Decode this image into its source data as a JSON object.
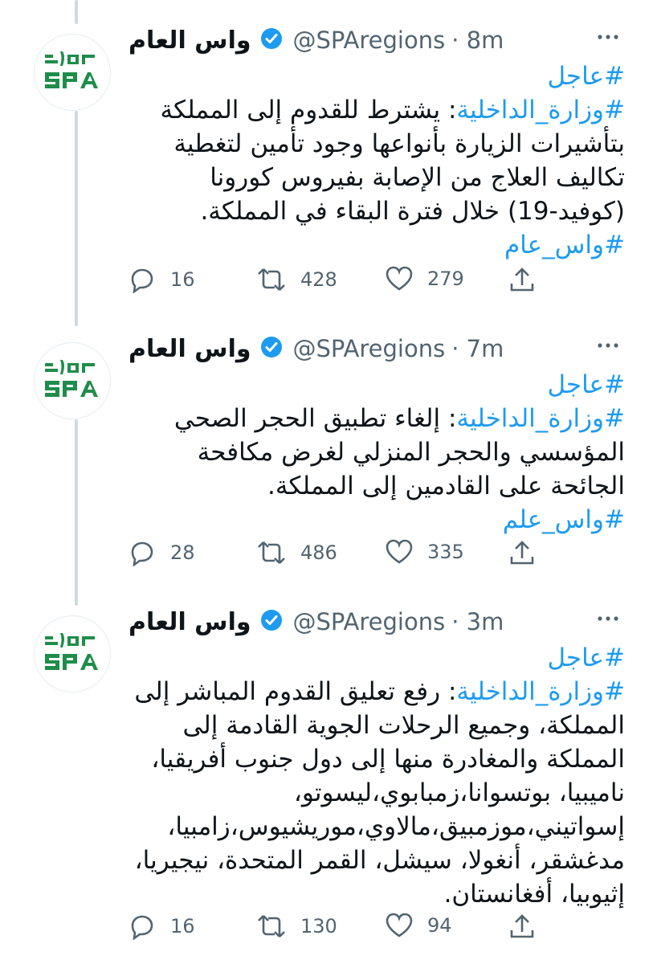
{
  "account": {
    "name": "واس العام",
    "handle": "@SPAregions",
    "verified": true,
    "logo_text": "واس SPA"
  },
  "colors": {
    "accent": "#1d9bf0",
    "logo_green": "#1f8d4a",
    "muted": "#536471"
  },
  "tweets": [
    {
      "time": "· 8m",
      "hashtag_urgent": "#عاجل",
      "ministry_tag": "#وزارة_الداخلية",
      "text": ": يشترط للقدوم إلى المملكة بتأشيرات الزيارة بأنواعها وجود تأمين لتغطية تكاليف العلاج من الإصابة بفيروس كورونا (كوفيد-19) خلال فترة البقاء في المملكة.",
      "footer_tag": "#واس_عام",
      "replies": "16",
      "retweets": "428",
      "likes": "279"
    },
    {
      "time": "· 7m",
      "hashtag_urgent": "#عاجل",
      "ministry_tag": "#وزارة_الداخلية",
      "text": ": إلغاء تطبيق الحجر الصحي المؤسسي والحجر المنزلي لغرض مكافحة الجائحة على القادمين إلى المملكة.",
      "footer_tag": "#واس_علم",
      "replies": "28",
      "retweets": "486",
      "likes": "335"
    },
    {
      "time": "· 3m",
      "hashtag_urgent": "#عاجل",
      "ministry_tag": "#وزارة_الداخلية",
      "text": ": رفع تعليق القدوم المباشر إلى المملكة، وجميع الرحلات الجوية القادمة إلى المملكة والمغادرة منها إلى دول جنوب أفريقيا، ناميبيا، بوتسوانا،زمبابوي،ليسوتو، إسواتيني،موزمبيق،مالاوي،موريشيوس،زامبيا، مدغشقر، أنغولا، سيشل، القمر المتحدة، نيجيريا، إثيوبيا، أفغانستان.",
      "footer_tag": "",
      "replies": "16",
      "retweets": "130",
      "likes": "94"
    }
  ]
}
